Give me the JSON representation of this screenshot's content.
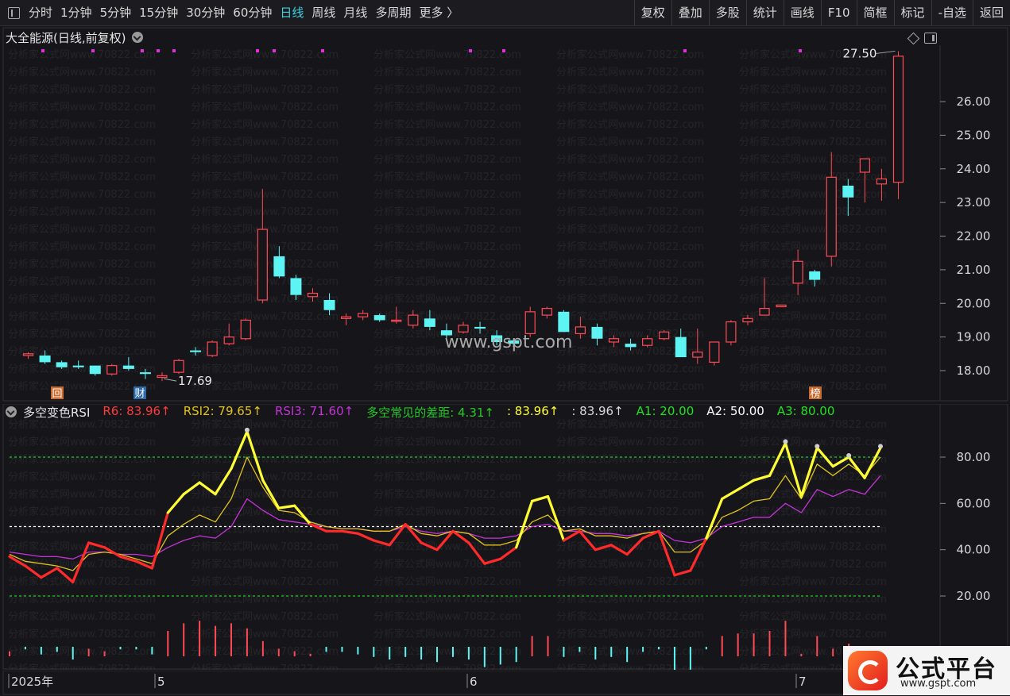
{
  "toolbar": {
    "periods": [
      "分时",
      "1分钟",
      "5分钟",
      "15分钟",
      "30分钟",
      "60分钟",
      "日线",
      "周线",
      "月线",
      "多周期",
      "更多 〉"
    ],
    "active": "日线",
    "right_buttons": [
      "复权",
      "叠加",
      "多股",
      "统计",
      "画线",
      "F10",
      "简框",
      "标记",
      "-自选",
      "返回"
    ]
  },
  "main": {
    "title": "大全能源(日线,前复权)",
    "price_ticks": [
      "26.00",
      "25.00",
      "24.00",
      "23.00",
      "22.00",
      "21.00",
      "20.00",
      "19.00",
      "18.00"
    ],
    "high_label": "27.50",
    "low_label": "17.69",
    "watermark_center": "www.gspt.com",
    "watermark_tile": "分析家公式网www.70822.com",
    "markers": [
      "回",
      "财",
      "榜"
    ]
  },
  "indicator": {
    "name": "多空变色RSI",
    "legend": [
      {
        "label": "R6: 83.96↑",
        "color": "#ff3b3b"
      },
      {
        "label": "RSI2: 79.65↑",
        "color": "#e0c21a"
      },
      {
        "label": "RSI3: 71.60↑",
        "color": "#c533d8"
      },
      {
        "label": "多空常见的差距: 4.31↑",
        "color": "#22c922"
      },
      {
        "label": ": 83.96↑",
        "color": "#ffff33"
      },
      {
        "label": ": 83.96↑",
        "color": "#d8d8d8"
      },
      {
        "label": "A1: 20.00",
        "color": "#22e022"
      },
      {
        "label": "A2: 50.00",
        "color": "#ffffff"
      },
      {
        "label": "A3: 80.00",
        "color": "#22e022"
      }
    ],
    "ticks": [
      "80.00",
      "60.00",
      "40.00",
      "20.00"
    ]
  },
  "time_axis": [
    "2025年",
    "5",
    "6",
    "7"
  ],
  "logo": {
    "title": "公式平台",
    "url": "www.gspt.com"
  },
  "chart_data": [
    {
      "type": "candlestick",
      "title": "大全能源(日线,前复权)",
      "ylim": [
        17.4,
        27.8
      ],
      "candles": [
        [
          18.45,
          18.55,
          18.35,
          18.5
        ],
        [
          18.45,
          18.6,
          18.2,
          18.25
        ],
        [
          18.25,
          18.3,
          18.05,
          18.1
        ],
        [
          18.15,
          18.3,
          18.05,
          18.1
        ],
        [
          18.15,
          18.15,
          17.85,
          17.9
        ],
        [
          17.9,
          18.2,
          17.85,
          18.15
        ],
        [
          18.15,
          18.4,
          18.0,
          18.05
        ],
        [
          17.95,
          18.05,
          17.75,
          17.9
        ],
        [
          17.8,
          17.95,
          17.69,
          17.85
        ],
        [
          17.95,
          18.35,
          17.9,
          18.3
        ],
        [
          18.6,
          18.7,
          18.45,
          18.55
        ],
        [
          18.45,
          18.9,
          18.4,
          18.85
        ],
        [
          18.8,
          19.4,
          18.75,
          19.0
        ],
        [
          18.95,
          19.55,
          18.9,
          19.5
        ],
        [
          20.1,
          23.4,
          20.0,
          22.2
        ],
        [
          21.4,
          21.7,
          20.75,
          20.8
        ],
        [
          20.75,
          20.85,
          20.1,
          20.25
        ],
        [
          20.2,
          20.45,
          20.05,
          20.3
        ],
        [
          20.1,
          20.3,
          19.65,
          19.8
        ],
        [
          19.55,
          19.7,
          19.35,
          19.6
        ],
        [
          19.6,
          19.8,
          19.5,
          19.7
        ],
        [
          19.65,
          19.7,
          19.45,
          19.5
        ],
        [
          19.5,
          19.9,
          19.4,
          19.5
        ],
        [
          19.35,
          19.8,
          19.25,
          19.65
        ],
        [
          19.55,
          19.8,
          19.2,
          19.3
        ],
        [
          19.2,
          19.4,
          18.95,
          19.05
        ],
        [
          19.15,
          19.45,
          19.1,
          19.35
        ],
        [
          19.3,
          19.45,
          19.1,
          19.25
        ],
        [
          19.05,
          19.2,
          18.75,
          18.85
        ],
        [
          18.9,
          18.95,
          18.7,
          18.8
        ],
        [
          19.1,
          19.9,
          19.0,
          19.75
        ],
        [
          19.65,
          19.9,
          19.55,
          19.85
        ],
        [
          19.75,
          19.8,
          19.15,
          19.15
        ],
        [
          19.1,
          19.6,
          18.95,
          19.3
        ],
        [
          19.3,
          19.4,
          18.75,
          18.95
        ],
        [
          18.85,
          19.05,
          18.7,
          18.95
        ],
        [
          18.8,
          18.95,
          18.6,
          18.7
        ],
        [
          18.75,
          19.05,
          18.7,
          18.95
        ],
        [
          18.95,
          19.2,
          18.9,
          19.15
        ],
        [
          19.0,
          19.25,
          18.45,
          18.4
        ],
        [
          18.4,
          19.25,
          18.2,
          18.55
        ],
        [
          18.25,
          18.85,
          18.15,
          18.85
        ],
        [
          18.85,
          19.5,
          18.75,
          19.45
        ],
        [
          19.45,
          19.65,
          19.35,
          19.55
        ],
        [
          19.65,
          20.75,
          19.65,
          19.85
        ],
        [
          19.9,
          19.95,
          19.9,
          19.95
        ],
        [
          20.6,
          21.6,
          20.25,
          21.25
        ],
        [
          20.95,
          21.0,
          20.5,
          20.7
        ],
        [
          21.4,
          24.5,
          21.1,
          23.75
        ],
        [
          23.5,
          23.7,
          22.6,
          23.15
        ],
        [
          23.9,
          24.3,
          23.0,
          24.3
        ],
        [
          23.55,
          24.0,
          23.05,
          23.7
        ],
        [
          23.6,
          27.5,
          23.1,
          27.35
        ]
      ]
    },
    {
      "type": "line",
      "title": "多空变色RSI",
      "ylim": [
        0,
        100
      ],
      "series": [
        {
          "name": "R6",
          "values": [
            37,
            33,
            28,
            32,
            26,
            43,
            41,
            37,
            35,
            32,
            56,
            64,
            69,
            64,
            75,
            91,
            70,
            58,
            59,
            51,
            48,
            48,
            47,
            44,
            42,
            51,
            43,
            40,
            48,
            43,
            34,
            36,
            41,
            61,
            63,
            44,
            48,
            40,
            42,
            38,
            45,
            48,
            29,
            31,
            45,
            62,
            66,
            70,
            72,
            86,
            63,
            84,
            76,
            80,
            71,
            84
          ]
        },
        {
          "name": "RSI2",
          "values": [
            38,
            35,
            34,
            33,
            31,
            38,
            39,
            38,
            36,
            34,
            46,
            51,
            55,
            52,
            62,
            80,
            67,
            57,
            56,
            52,
            50,
            49,
            49,
            48,
            48,
            51,
            47,
            46,
            48,
            47,
            42,
            42,
            44,
            52,
            55,
            48,
            49,
            46,
            46,
            45,
            47,
            48,
            39,
            39,
            44,
            54,
            57,
            61,
            62,
            72,
            62,
            77,
            72,
            77,
            72,
            80
          ]
        },
        {
          "name": "RSI3",
          "values": [
            39,
            38,
            37,
            37,
            36,
            39,
            39,
            38,
            38,
            37,
            41,
            44,
            46,
            45,
            50,
            62,
            57,
            53,
            52,
            51,
            50,
            49,
            49,
            48,
            48,
            50,
            48,
            47,
            48,
            47,
            45,
            45,
            46,
            50,
            51,
            48,
            48,
            47,
            47,
            46,
            47,
            48,
            44,
            43,
            45,
            50,
            52,
            54,
            54,
            60,
            56,
            66,
            63,
            66,
            64,
            72
          ]
        }
      ],
      "levels": [
        {
          "name": "A1",
          "value": 20
        },
        {
          "name": "A2",
          "value": 50
        },
        {
          "name": "A3",
          "value": 80
        }
      ]
    },
    {
      "type": "bar",
      "title": "多空常见的差距",
      "values": [
        2,
        -1,
        -3,
        -2,
        -5,
        3,
        2,
        -1,
        -1,
        -3,
        10,
        13,
        14,
        12,
        13,
        11,
        6,
        3,
        2,
        1,
        -2,
        -2,
        -3,
        -4,
        -5,
        -4,
        -5,
        -6,
        -4,
        -5,
        -8,
        -7,
        -6,
        8,
        8,
        -4,
        -2,
        -5,
        -4,
        -6,
        -2,
        -1,
        -10,
        -9,
        -1,
        8,
        9,
        9,
        10,
        14,
        1,
        8,
        3,
        5,
        1,
        4
      ]
    }
  ]
}
